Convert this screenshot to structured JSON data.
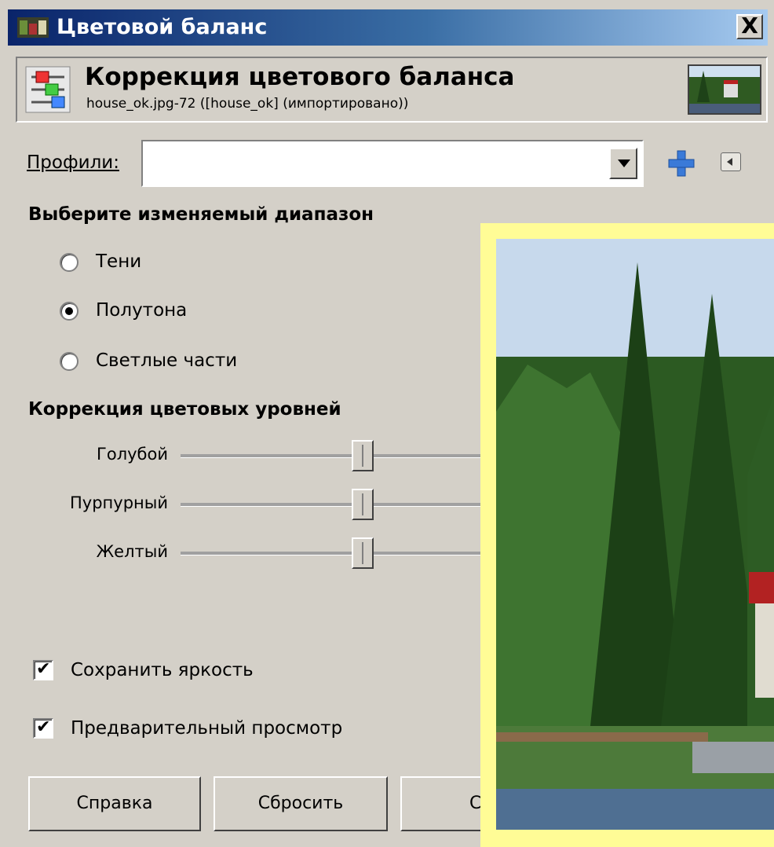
{
  "window": {
    "title": "Цветовой баланс",
    "close": "X"
  },
  "header": {
    "title": "Коррекция цветового баланса",
    "subtitle": "house_ok.jpg-72 ([house_ok] (импортировано))"
  },
  "profiles": {
    "label": "Профили:",
    "value": ""
  },
  "range": {
    "heading": "Выберите изменяемый диапазон",
    "options": [
      {
        "label": "Тени",
        "selected": false
      },
      {
        "label": "Полутона",
        "selected": true
      },
      {
        "label": "Светлые части",
        "selected": false
      }
    ]
  },
  "levels": {
    "heading": "Коррекция цветовых уровней",
    "sliders": [
      {
        "label": "Голубой",
        "value": 0
      },
      {
        "label": "Пурпурный",
        "value": 0
      },
      {
        "label": "Желтый",
        "value": 0
      }
    ]
  },
  "options": {
    "preserve_luminosity": "Сохранить яркость",
    "preview": "Предварительный просмотр"
  },
  "buttons": {
    "help": "Справка",
    "reset": "Сбросить",
    "third_partial": "С"
  },
  "icons": {
    "plus": "plus-icon",
    "menu": "menu-arrow-icon",
    "tool": "color-balance-icon"
  },
  "colors": {
    "titlebar_start": "#0a246a",
    "titlebar_end": "#a6caf0",
    "preview_border": "#fffc96"
  }
}
